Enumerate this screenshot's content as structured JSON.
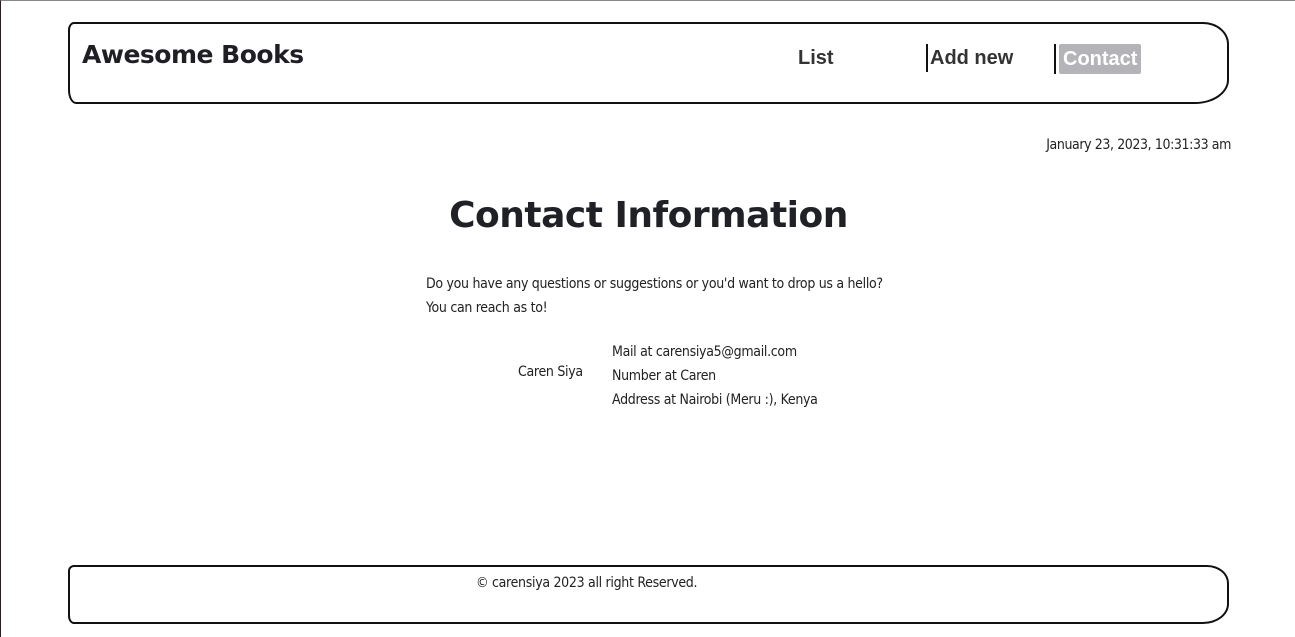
{
  "header": {
    "logo": "Awesome Books",
    "nav": {
      "list": "List",
      "add_new": "Add new",
      "contact": "Contact"
    }
  },
  "datetime": "January 23, 2023, 10:31:33 am",
  "contact": {
    "title": "Contact Information",
    "intro_line1": "Do you have any questions or suggestions or you'd want to drop us a hello?",
    "intro_line2": "You can reach as to!",
    "name": "Caren Siya",
    "details": {
      "mail": "Mail at carensiya5@gmail.com",
      "number": "Number at Caren",
      "address": "Address at Nairobi (Meru :), Kenya"
    }
  },
  "footer": {
    "copyright": "© carensiya 2023 all right Reserved."
  },
  "colors": {
    "active_nav_bg": "#b4b4b8",
    "text": "#222222"
  }
}
